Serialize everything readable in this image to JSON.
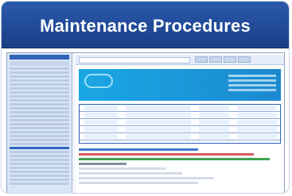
{
  "banner": {
    "title": "Maintenance Procedures"
  }
}
